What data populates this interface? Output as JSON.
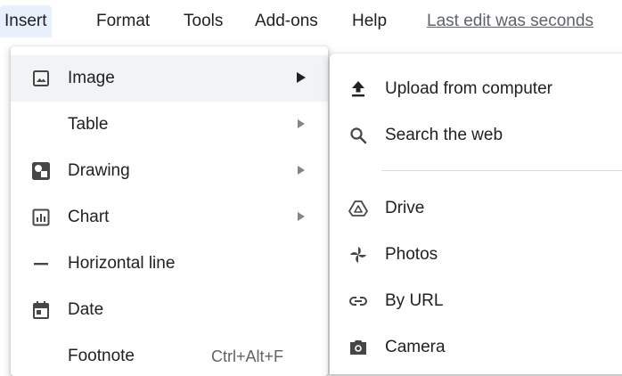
{
  "menubar": {
    "items": [
      {
        "label": "Insert",
        "active": true
      },
      {
        "label": "Format"
      },
      {
        "label": "Tools"
      },
      {
        "label": "Add-ons"
      },
      {
        "label": "Help"
      }
    ],
    "last_edit": "Last edit was seconds"
  },
  "insert_menu": {
    "items": [
      {
        "label": "Image",
        "icon": "image-icon",
        "has_submenu": true,
        "highlighted": true
      },
      {
        "label": "Table",
        "icon": null,
        "has_submenu": true
      },
      {
        "label": "Drawing",
        "icon": "drawing-icon",
        "has_submenu": true
      },
      {
        "label": "Chart",
        "icon": "chart-icon",
        "has_submenu": true
      },
      {
        "label": "Horizontal line",
        "icon": "horizontal-line-icon"
      },
      {
        "label": "Date",
        "icon": "calendar-icon"
      },
      {
        "label": "Footnote",
        "icon": null,
        "shortcut": "Ctrl+Alt+F"
      }
    ]
  },
  "image_submenu": {
    "items": [
      {
        "label": "Upload from computer",
        "icon": "upload-icon"
      },
      {
        "label": "Search the web",
        "icon": "search-icon"
      },
      {
        "label": "Drive",
        "icon": "drive-icon"
      },
      {
        "label": "Photos",
        "icon": "photos-icon"
      },
      {
        "label": "By URL",
        "icon": "link-icon"
      },
      {
        "label": "Camera",
        "icon": "camera-icon"
      }
    ]
  },
  "colors": {
    "active_menubar_bg": "#e8f0fe",
    "highlight_bg": "#f1f3f4",
    "icon": "#444746",
    "text": "#202124",
    "secondary_text": "#5f6368"
  }
}
